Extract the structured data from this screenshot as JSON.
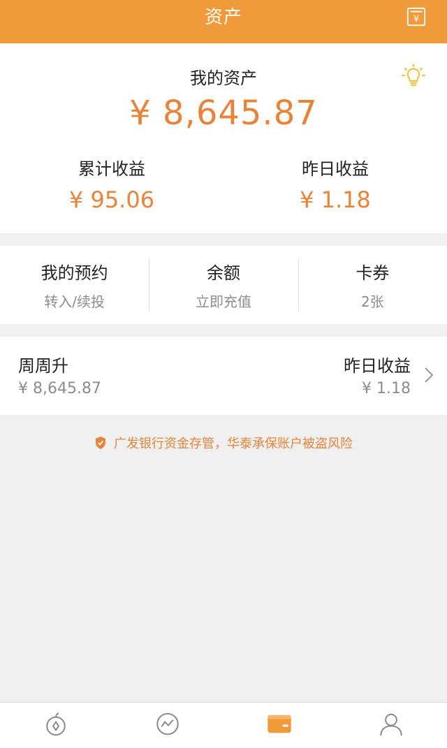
{
  "header": {
    "title": "资产",
    "icon": "wallet-yuan-icon"
  },
  "asset": {
    "title": "我的资产",
    "total": "¥ 8,645.87",
    "cumulative_label": "累计收益",
    "cumulative_value": "¥ 95.06",
    "yesterday_label": "昨日收益",
    "yesterday_value": "¥ 1.18",
    "tip_icon": "lightbulb-icon"
  },
  "actions": [
    {
      "title": "我的预约",
      "sub": "转入/续投"
    },
    {
      "title": "余额",
      "sub": "立即充值"
    },
    {
      "title": "卡券",
      "sub": "2张"
    }
  ],
  "product": {
    "name": "周周升",
    "amount": "¥ 8,645.87",
    "yesterday_label": "昨日收益",
    "yesterday_value": "¥ 1.18"
  },
  "notice": {
    "text": "广发银行资金存管，华泰承保账户被盗风险"
  },
  "tabs": [
    {
      "icon": "coin-icon",
      "label": "",
      "active": false
    },
    {
      "icon": "trend-chart-icon",
      "label": "",
      "active": false
    },
    {
      "icon": "card-icon",
      "label": "",
      "active": true
    },
    {
      "icon": "person-icon",
      "label": "",
      "active": false
    }
  ],
  "colors": {
    "brand": "#f09a3a",
    "accent": "#e8843a",
    "muted": "#8c8c8c",
    "background": "#f0f0f0"
  }
}
